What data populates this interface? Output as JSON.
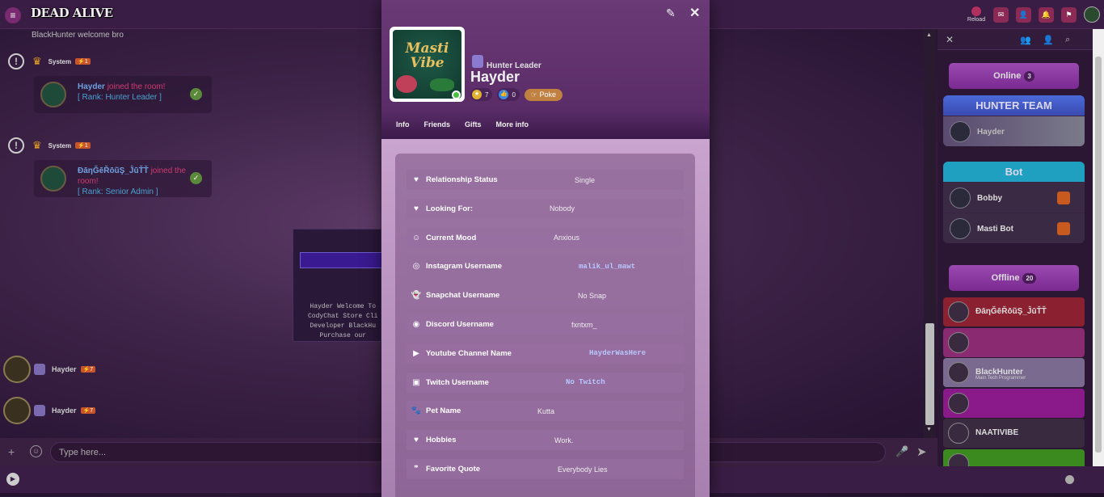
{
  "app": {
    "logo": "DEAD ALIVE",
    "reload_label": "Reload"
  },
  "chat": {
    "top_message": "BlackHunter welcome bro",
    "system_name": "System",
    "system_badge": "⚡1",
    "join1": {
      "name": "Hayder",
      "action": "joined the room!",
      "rank": "[ Rank: Hunter Leader ]"
    },
    "join2": {
      "name": "ĐāηĞēŘōũŞ_ĴūŤŤ",
      "action": "joined the room!",
      "rank": "[ Rank: Senior Admin ]"
    },
    "ghost_text": "Hayder Welcome To\nCodyChat Store Cli\nDeveloper BlackHu\nPurchase our",
    "msgs": [
      {
        "name": "Hayder",
        "level": "⚡7"
      },
      {
        "name": "Hayder",
        "level": "⚡7"
      }
    ],
    "input_placeholder": "Type here..."
  },
  "profile": {
    "rank": "Hunter Leader",
    "username": "Hayder",
    "avatar_text": "Masti Vibe",
    "gold": "7",
    "likes": "0",
    "poke_label": "Poke",
    "tabs": [
      "Info",
      "Friends",
      "Gifts",
      "More info"
    ],
    "fields": [
      {
        "icon": "heart-icon",
        "label": "Relationship Status",
        "value": "Single",
        "mono": false
      },
      {
        "icon": "heart-icon",
        "label": "Looking For:",
        "value": "Nobody",
        "mono": false
      },
      {
        "icon": "smiley-icon",
        "label": "Current Mood",
        "value": "Anxious",
        "mono": false
      },
      {
        "icon": "instagram-icon",
        "label": "Instagram Username",
        "value": "malik_ul_mawt",
        "mono": true
      },
      {
        "icon": "snapchat-icon",
        "label": "Snapchat Username",
        "value": "No Snap",
        "mono": false
      },
      {
        "icon": "discord-icon",
        "label": "Discord Username",
        "value": "fxntxm_",
        "mono": false
      },
      {
        "icon": "youtube-icon",
        "label": "Youtube Channel Name",
        "value": "HayderWasHere",
        "mono": true
      },
      {
        "icon": "twitch-icon",
        "label": "Twitch Username",
        "value": "No Twitch",
        "mono": true
      },
      {
        "icon": "paw-icon",
        "label": "Pet Name",
        "value": "Kutta",
        "mono": false
      },
      {
        "icon": "heart-icon",
        "label": "Hobbies",
        "value": "Work.",
        "mono": false
      },
      {
        "icon": "quote-icon",
        "label": "Favorite Quote",
        "value": "Everybody Lies",
        "mono": false
      }
    ]
  },
  "userlist": {
    "online_label": "Online",
    "online_count": "3",
    "hunter_team": "HUNTER TEAM",
    "hunter_member": "Hayder",
    "bot_label": "Bot",
    "bots": [
      "Bobby",
      "Masti Bot"
    ],
    "offline_label": "Offline",
    "offline_count": "20",
    "offline": [
      {
        "name": "ĐāηĞēŘōũŞ_ĴūŤŤ",
        "sub": "",
        "color": "#8a2030"
      },
      {
        "name": "",
        "sub": "",
        "color": "#8a2a70"
      },
      {
        "name": "BlackHunter",
        "sub": "Main Tech Programmer",
        "color": "#7a6a90"
      },
      {
        "name": "",
        "sub": "",
        "color": "#8a1a8a"
      },
      {
        "name": "NAATIVIBE",
        "sub": "",
        "color": "#3a2a40"
      },
      {
        "name": "",
        "sub": "",
        "color": "#3a8a20"
      }
    ]
  },
  "colors": {
    "accent": "#7a2a90",
    "online_green": "#4ac040",
    "poke": "#c08040"
  }
}
